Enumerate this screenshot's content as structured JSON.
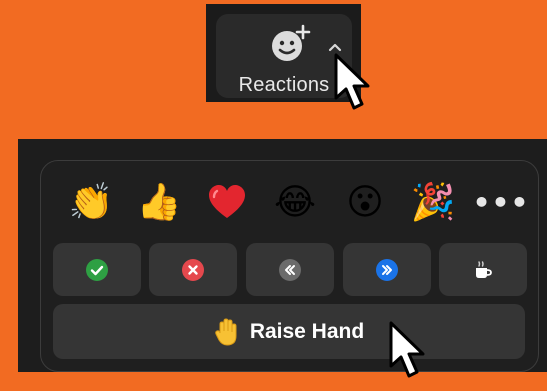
{
  "toolbar": {
    "reactions_label": "Reactions",
    "reactions_icon": "smiley-add-icon",
    "caret_icon": "chevron-up-icon"
  },
  "reactions_panel": {
    "emojis": [
      {
        "name": "clapping-hands",
        "glyph": "👏"
      },
      {
        "name": "thumbs-up",
        "glyph": "👍"
      },
      {
        "name": "red-heart",
        "glyph": "❤"
      },
      {
        "name": "tears-of-joy",
        "glyph": "😂"
      },
      {
        "name": "open-mouth",
        "glyph": "😮"
      },
      {
        "name": "party-popper",
        "glyph": "🎉"
      }
    ],
    "more_label": "•••",
    "status_buttons": [
      {
        "name": "yes",
        "icon": "check-icon",
        "color": "#2ea043"
      },
      {
        "name": "no",
        "icon": "x-icon",
        "color": "#e5484d"
      },
      {
        "name": "slow-down",
        "icon": "rewind-icon",
        "color": "#6b6b6b"
      },
      {
        "name": "speed-up",
        "icon": "fast-forward-icon",
        "color": "#1a73e8"
      },
      {
        "name": "coffee",
        "icon": "coffee-icon",
        "color": "#ffffff"
      }
    ],
    "raise_hand_label": "Raise Hand",
    "raise_hand_glyph": "✋"
  },
  "colors": {
    "background": "#f26b22",
    "panel": "#1f1f1f",
    "button": "#353535"
  }
}
